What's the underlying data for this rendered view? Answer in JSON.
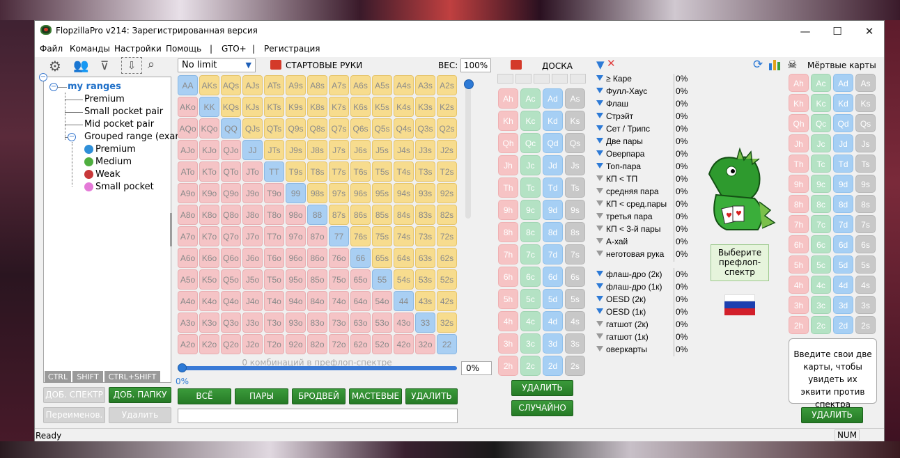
{
  "window": {
    "title": "FlopzillaPro v214: Зарегистрированная версия",
    "minimize": "—",
    "maximize": "☐",
    "close": "✕"
  },
  "menu": [
    "Файл",
    "Команды",
    "Настройки",
    "Помощь",
    "|",
    "GTO+",
    "|",
    "Регистрация"
  ],
  "tree": {
    "root": "my ranges",
    "items": [
      "Premium",
      "Small pocket pair",
      "Mid pocket pair",
      "Grouped range (exar"
    ],
    "groups": [
      {
        "label": "Premium",
        "color": "#2f8fd8"
      },
      {
        "label": "Medium",
        "color": "#4fae3f"
      },
      {
        "label": "Weak",
        "color": "#c8383a"
      },
      {
        "label": "Small pocket",
        "color": "#e47ad8"
      }
    ]
  },
  "keys": [
    "CTRL",
    "SHIFT",
    "CTRL+SHIFT"
  ],
  "left_buttons": {
    "add_spectrum": "ДОБ. СПЕКТР",
    "add_folder": "ДОБ. ПАПКУ",
    "rename": "Переименов.",
    "delete": "Удалить"
  },
  "starting_hands": {
    "limit": "No limit",
    "title": "СТАРТОВЫЕ РУКИ",
    "weight_label": "ВЕС:",
    "weight": "100%",
    "combos": "0 комбинаций в префлоп-спектре",
    "slider_pct": "0%",
    "pct_box": "0%",
    "grid": [
      [
        "AA",
        "AKs",
        "AQs",
        "AJs",
        "ATs",
        "A9s",
        "A8s",
        "A7s",
        "A6s",
        "A5s",
        "A4s",
        "A3s",
        "A2s"
      ],
      [
        "AKo",
        "KK",
        "KQs",
        "KJs",
        "KTs",
        "K9s",
        "K8s",
        "K7s",
        "K6s",
        "K5s",
        "K4s",
        "K3s",
        "K2s"
      ],
      [
        "AQo",
        "KQo",
        "QQ",
        "QJs",
        "QTs",
        "Q9s",
        "Q8s",
        "Q7s",
        "Q6s",
        "Q5s",
        "Q4s",
        "Q3s",
        "Q2s"
      ],
      [
        "AJo",
        "KJo",
        "QJo",
        "JJ",
        "JTs",
        "J9s",
        "J8s",
        "J7s",
        "J6s",
        "J5s",
        "J4s",
        "J3s",
        "J2s"
      ],
      [
        "ATo",
        "KTo",
        "QTo",
        "JTo",
        "TT",
        "T9s",
        "T8s",
        "T7s",
        "T6s",
        "T5s",
        "T4s",
        "T3s",
        "T2s"
      ],
      [
        "A9o",
        "K9o",
        "Q9o",
        "J9o",
        "T9o",
        "99",
        "98s",
        "97s",
        "96s",
        "95s",
        "94s",
        "93s",
        "92s"
      ],
      [
        "A8o",
        "K8o",
        "Q8o",
        "J8o",
        "T8o",
        "98o",
        "88",
        "87s",
        "86s",
        "85s",
        "84s",
        "83s",
        "82s"
      ],
      [
        "A7o",
        "K7o",
        "Q7o",
        "J7o",
        "T7o",
        "97o",
        "87o",
        "77",
        "76s",
        "75s",
        "74s",
        "73s",
        "72s"
      ],
      [
        "A6o",
        "K6o",
        "Q6o",
        "J6o",
        "T6o",
        "96o",
        "86o",
        "76o",
        "66",
        "65s",
        "64s",
        "63s",
        "62s"
      ],
      [
        "A5o",
        "K5o",
        "Q5o",
        "J5o",
        "T5o",
        "95o",
        "85o",
        "75o",
        "65o",
        "55",
        "54s",
        "53s",
        "52s"
      ],
      [
        "A4o",
        "K4o",
        "Q4o",
        "J4o",
        "T4o",
        "94o",
        "84o",
        "74o",
        "64o",
        "54o",
        "44",
        "43s",
        "42s"
      ],
      [
        "A3o",
        "K3o",
        "Q3o",
        "J3o",
        "T3o",
        "93o",
        "83o",
        "73o",
        "63o",
        "53o",
        "43o",
        "33",
        "32s"
      ],
      [
        "A2o",
        "K2o",
        "Q2o",
        "J2o",
        "T2o",
        "92o",
        "82o",
        "72o",
        "62o",
        "52o",
        "42o",
        "32o",
        "22"
      ]
    ],
    "buttons": [
      "ВСЁ",
      "ПАРЫ",
      "БРОДВЕЙ",
      "МАСТЕВЫЕ",
      "УДАЛИТЬ"
    ]
  },
  "board": {
    "title": "ДОСКА",
    "ranks": [
      "A",
      "K",
      "Q",
      "J",
      "T",
      "9",
      "8",
      "7",
      "6",
      "5",
      "4",
      "3",
      "2"
    ],
    "suits": [
      "h",
      "c",
      "d",
      "s"
    ],
    "delete": "УДАЛИТЬ",
    "random": "СЛУЧАЙНО"
  },
  "stats": {
    "made": [
      {
        "label": "≥ Каре",
        "value": "0%",
        "active": true
      },
      {
        "label": "Фулл-Хаус",
        "value": "0%",
        "active": true
      },
      {
        "label": "Флаш",
        "value": "0%",
        "active": true
      },
      {
        "label": "Стрэйт",
        "value": "0%",
        "active": true
      },
      {
        "label": "Сет / Трипс",
        "value": "0%",
        "active": true
      },
      {
        "label": "Две пары",
        "value": "0%",
        "active": true
      },
      {
        "label": "Оверпара",
        "value": "0%",
        "active": true
      },
      {
        "label": "Топ-пара",
        "value": "0%",
        "active": true
      },
      {
        "label": "КП < ТП",
        "value": "0%",
        "active": false
      },
      {
        "label": "средняя пара",
        "value": "0%",
        "active": false
      },
      {
        "label": "КП < сред.пары",
        "value": "0%",
        "active": false
      },
      {
        "label": "третья пара",
        "value": "0%",
        "active": false
      },
      {
        "label": "КП < 3-й пары",
        "value": "0%",
        "active": false
      },
      {
        "label": "А-хай",
        "value": "0%",
        "active": false
      },
      {
        "label": "неготовая рука",
        "value": "0%",
        "active": false
      }
    ],
    "draws": [
      {
        "label": "флаш-дро (2к)",
        "value": "0%",
        "active": true
      },
      {
        "label": "флаш-дро (1к)",
        "value": "0%",
        "active": true
      },
      {
        "label": "OESD (2к)",
        "value": "0%",
        "active": true
      },
      {
        "label": "OESD (1к)",
        "value": "0%",
        "active": true
      },
      {
        "label": "гатшот (2к)",
        "value": "0%",
        "active": false
      },
      {
        "label": "гатшот (1к)",
        "value": "0%",
        "active": false
      },
      {
        "label": "оверкарты",
        "value": "0%",
        "active": false
      }
    ]
  },
  "mascot_bubble": "Выберите префлоп-спектр",
  "dead": {
    "title": "Мёртвые карты",
    "hint": "Введите свои две карты, чтобы увидеть их эквити против спектра",
    "delete": "УДАЛИТЬ"
  },
  "status": {
    "left": "Ready",
    "right": "NUM"
  }
}
